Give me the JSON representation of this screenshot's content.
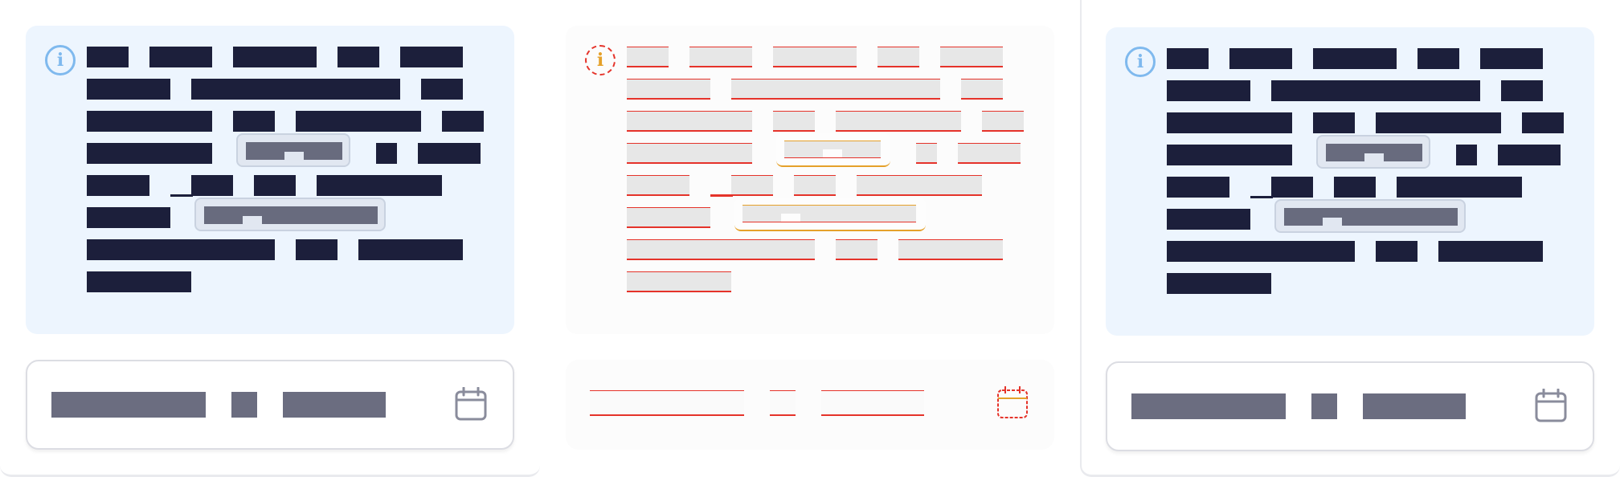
{
  "icons": {
    "info": "info-icon",
    "calendar": "calendar-icon"
  },
  "colors": {
    "text_block": "#1c1f3b",
    "info_bg": "#edf5fe",
    "info_icon": "#7fb9ee",
    "chip_bg": "#e1e7f1",
    "muted_text": "#6b6d80",
    "debug_red": "#e5332a",
    "debug_orange": "#e5a12a",
    "active_tab_blue": "#6d7de8"
  },
  "panels": [
    {
      "variant": "normal",
      "info_paragraph": [
        [
          "",
          "",
          "",
          "",
          ""
        ],
        [
          "",
          "",
          ""
        ],
        [
          "",
          "",
          "",
          ""
        ],
        [
          "",
          "",
          "",
          ""
        ],
        [
          "",
          "",
          "",
          "",
          ""
        ],
        [
          "",
          ""
        ],
        [
          "",
          "",
          ""
        ],
        [
          ""
        ]
      ],
      "date_range": {
        "start": "",
        "separator": "",
        "end": ""
      }
    },
    {
      "variant": "debug-overlay",
      "info_paragraph": [
        [
          "",
          "",
          "",
          "",
          ""
        ],
        [
          "",
          "",
          ""
        ],
        [
          "",
          "",
          "",
          ""
        ],
        [
          "",
          "",
          "",
          ""
        ],
        [
          "",
          "",
          "",
          "",
          ""
        ],
        [
          "",
          ""
        ],
        [
          "",
          "",
          ""
        ],
        [
          ""
        ]
      ],
      "date_range": {
        "start": "",
        "separator": "",
        "end": ""
      }
    },
    {
      "variant": "normal",
      "info_paragraph": [
        [
          "",
          "",
          "",
          "",
          ""
        ],
        [
          "",
          "",
          ""
        ],
        [
          "",
          "",
          "",
          ""
        ],
        [
          "",
          "",
          "",
          ""
        ],
        [
          "",
          "",
          "",
          "",
          ""
        ],
        [
          "",
          ""
        ],
        [
          "",
          "",
          ""
        ],
        [
          ""
        ]
      ],
      "date_range": {
        "start": "",
        "separator": "",
        "end": ""
      }
    }
  ]
}
